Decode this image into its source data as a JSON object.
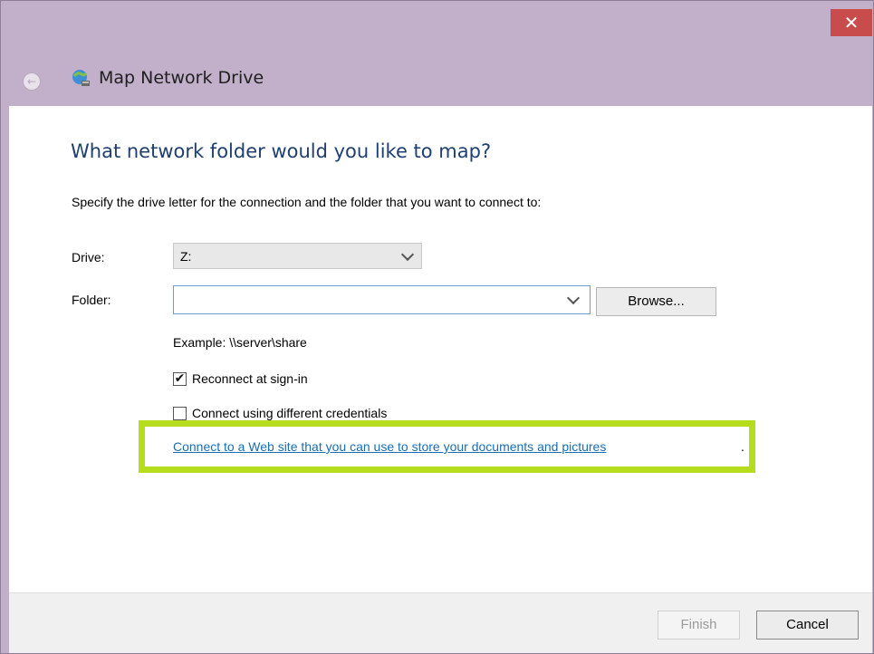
{
  "window": {
    "title": "Map Network Drive",
    "close_glyph": "✕",
    "back_glyph": "←",
    "icons": {
      "close": "close-icon",
      "back": "back-arrow-icon",
      "app": "network-drive-icon"
    }
  },
  "content": {
    "heading": "What network folder would you like to map?",
    "instruction": "Specify the drive letter for the connection and the folder that you want to connect to:",
    "drive": {
      "label": "Drive:",
      "value": "Z:"
    },
    "folder": {
      "label": "Folder:",
      "value": "",
      "placeholder": ""
    },
    "browse_label": "Browse...",
    "example": "Example: \\\\server\\share",
    "checkboxes": [
      {
        "label": "Reconnect at sign-in",
        "checked": true
      },
      {
        "label": "Connect using different credentials",
        "checked": false
      }
    ],
    "web_link": "Connect to a Web site that you can use to store your documents and pictures",
    "web_link_suffix": "."
  },
  "footer": {
    "finish_label": "Finish",
    "cancel_label": "Cancel"
  },
  "colors": {
    "titlebar": "#c2afc9",
    "close_button": "#c94c4c",
    "heading": "#1e3f6f",
    "link": "#1a6eb4",
    "highlight": "#b6dc1e"
  }
}
